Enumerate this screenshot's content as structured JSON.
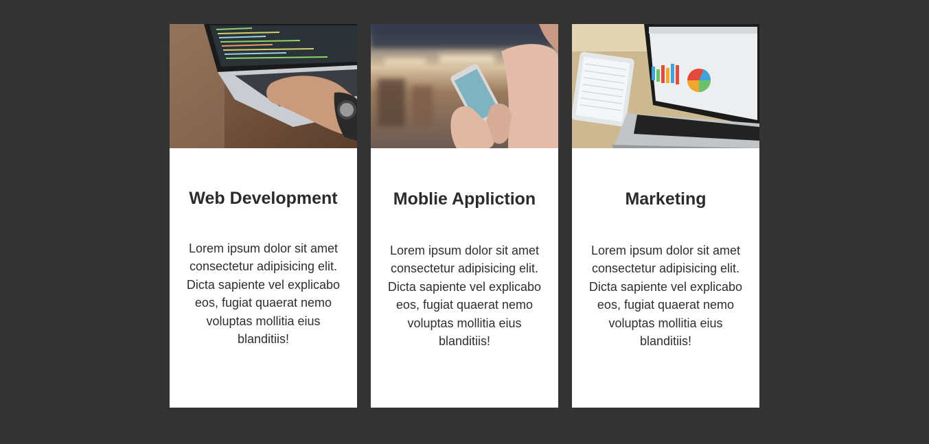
{
  "cards": [
    {
      "title": "Web Development",
      "text": "Lorem ipsum dolor sit amet consectetur adipisicing elit. Dicta sapiente vel explicabo eos, fugiat quaerat nemo voluptas mollitia eius blanditiis!",
      "image_icon": "laptop-coding-photo"
    },
    {
      "title": "Moblie Appliction",
      "text": "Lorem ipsum dolor sit amet consectetur adipisicing elit. Dicta sapiente vel explicabo eos, fugiat quaerat nemo voluptas mollitia eius blanditiis!",
      "image_icon": "smartphone-hands-photo"
    },
    {
      "title": "Marketing",
      "text": "Lorem ipsum dolor sit amet consectetur adipisicing elit. Dicta sapiente vel explicabo eos, fugiat quaerat nemo voluptas mollitia eius blanditiis!",
      "image_icon": "laptop-charts-photo"
    }
  ],
  "colors": {
    "background": "#333333",
    "card": "#ffffff",
    "text": "#2b2b2b"
  }
}
